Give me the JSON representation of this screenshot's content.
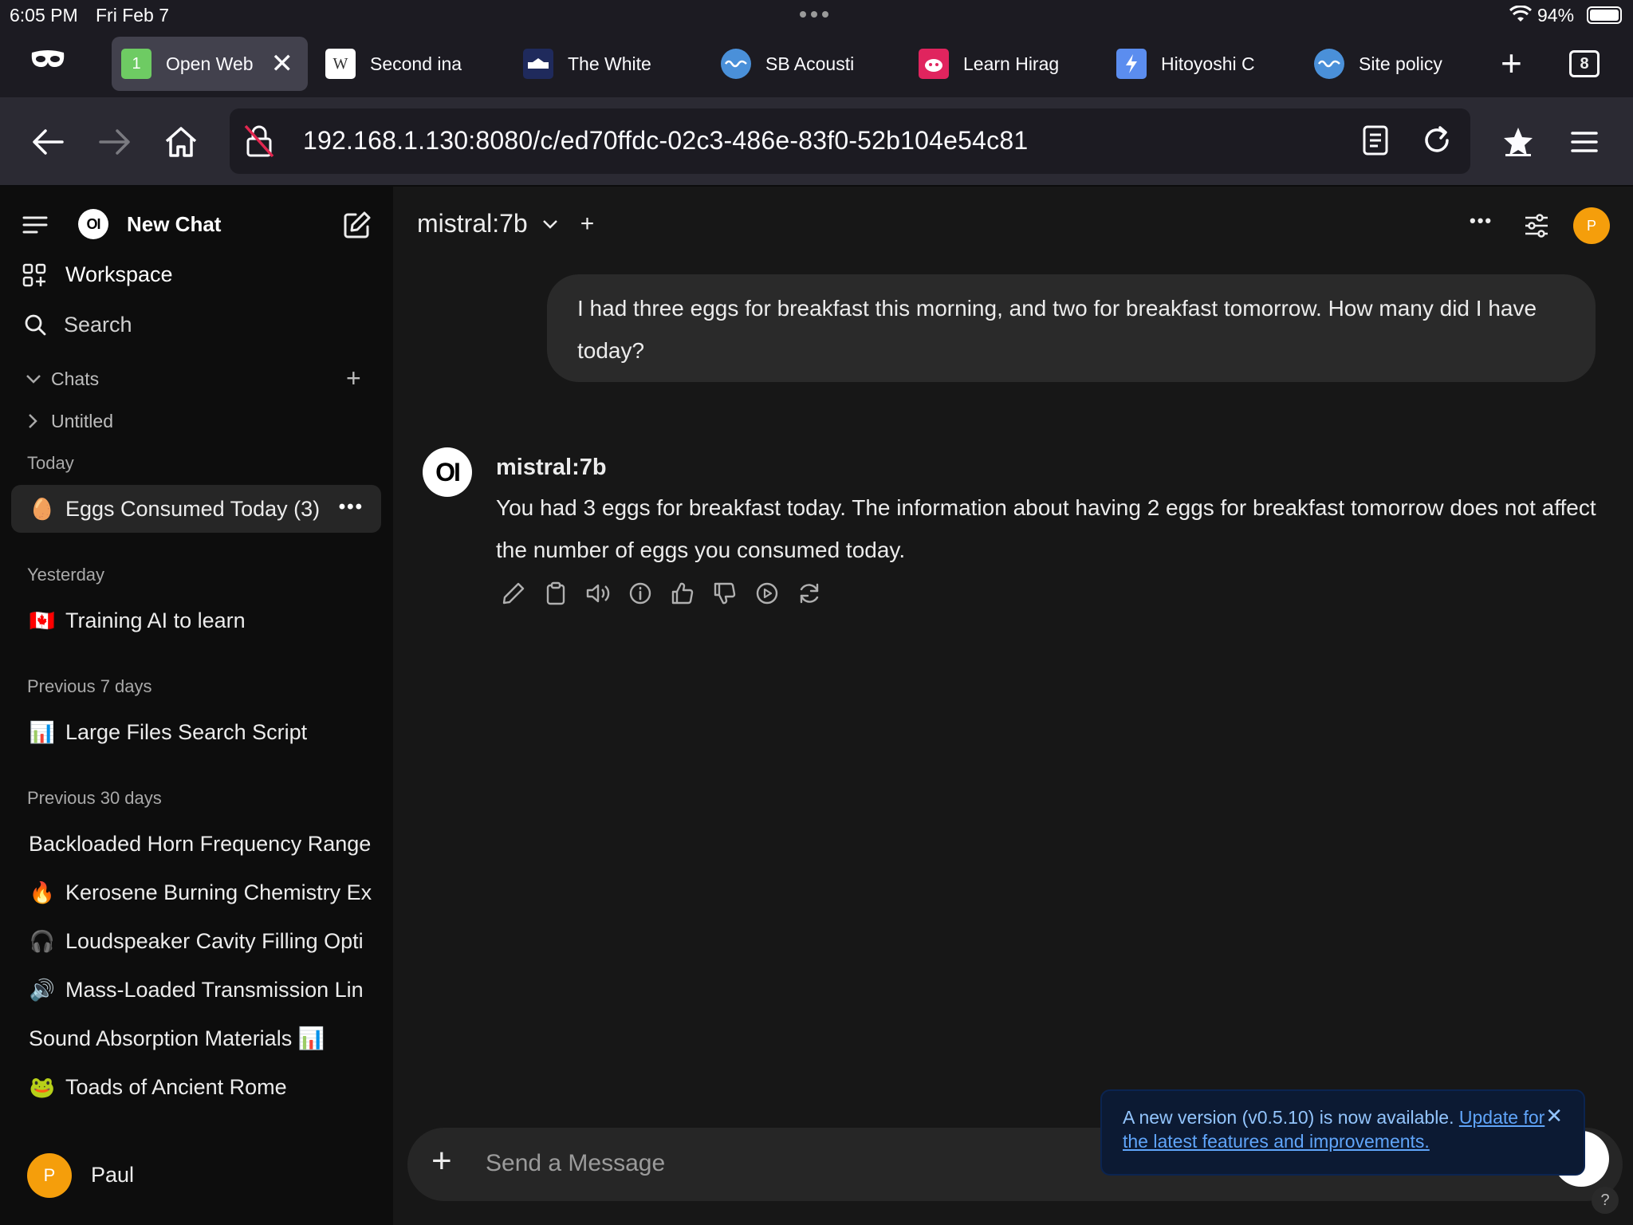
{
  "status": {
    "time": "6:05 PM",
    "date": "Fri Feb 7",
    "battery": "94%"
  },
  "tabs": {
    "items": [
      {
        "label": "Open Web",
        "favicon_text": "1",
        "favicon_color": "#6ecb63"
      },
      {
        "label": "Second ina",
        "favicon_text": "W",
        "favicon_color": "#ffffff"
      },
      {
        "label": "The White",
        "favicon_text": "",
        "favicon_color": "#1f2a5c"
      },
      {
        "label": "SB Acousti",
        "favicon_text": "",
        "favicon_color": "#4a90d9"
      },
      {
        "label": "Learn Hirag",
        "favicon_text": "",
        "favicon_color": "#e0245e"
      },
      {
        "label": "Hitoyoshi C",
        "favicon_text": "",
        "favicon_color": "#5b8def"
      },
      {
        "label": "Site policy",
        "favicon_text": "",
        "favicon_color": "#4a90d9"
      }
    ],
    "count": "8"
  },
  "nav": {
    "url": "192.168.1.130:8080/c/ed70ffdc-02c3-486e-83f0-52b104e54c81"
  },
  "sidebar": {
    "logo_text": "OI",
    "new_chat": "New Chat",
    "workspace": "Workspace",
    "search": "Search",
    "chats_label": "Chats",
    "folder": "Untitled",
    "sections": {
      "today": "Today",
      "yesterday": "Yesterday",
      "prev7": "Previous 7 days",
      "prev30": "Previous 30 days"
    },
    "today_items": [
      {
        "emoji": "🥚",
        "title": "Eggs Consumed Today (3)"
      }
    ],
    "yesterday_items": [
      {
        "emoji": "🇨🇦",
        "title": "Training AI to learn"
      }
    ],
    "prev7_items": [
      {
        "emoji": "📊",
        "title": "Large Files Search Script"
      }
    ],
    "prev30_items": [
      {
        "emoji": "",
        "title": "Backloaded Horn Frequency Range"
      },
      {
        "emoji": "🔥",
        "title": "Kerosene Burning Chemistry Ex"
      },
      {
        "emoji": "🎧",
        "title": "Loudspeaker Cavity Filling Opti"
      },
      {
        "emoji": "🔊",
        "title": "Mass-Loaded Transmission Lin"
      },
      {
        "emoji": "",
        "title": "Sound Absorption Materials 📊"
      },
      {
        "emoji": "🐸",
        "title": "Toads of Ancient Rome"
      }
    ],
    "user": {
      "initial": "P",
      "name": "Paul"
    }
  },
  "main": {
    "model": "mistral:7b",
    "user_avatar": "P",
    "user_message": "I had three eggs for breakfast this morning, and two for breakfast tomorrow. How many did I have today?",
    "assistant_name": "mistral:7b",
    "assistant_logo": "OI",
    "assistant_message": "You had 3 eggs for breakfast today. The information about having 2 eggs for breakfast tomorrow does not affect the number of eggs you consumed today.",
    "input_placeholder": "Send a Message",
    "toast": {
      "text": "A new version (v0.5.10) is now available. ",
      "link": "Update for the latest features and improvements."
    },
    "help": "?"
  }
}
